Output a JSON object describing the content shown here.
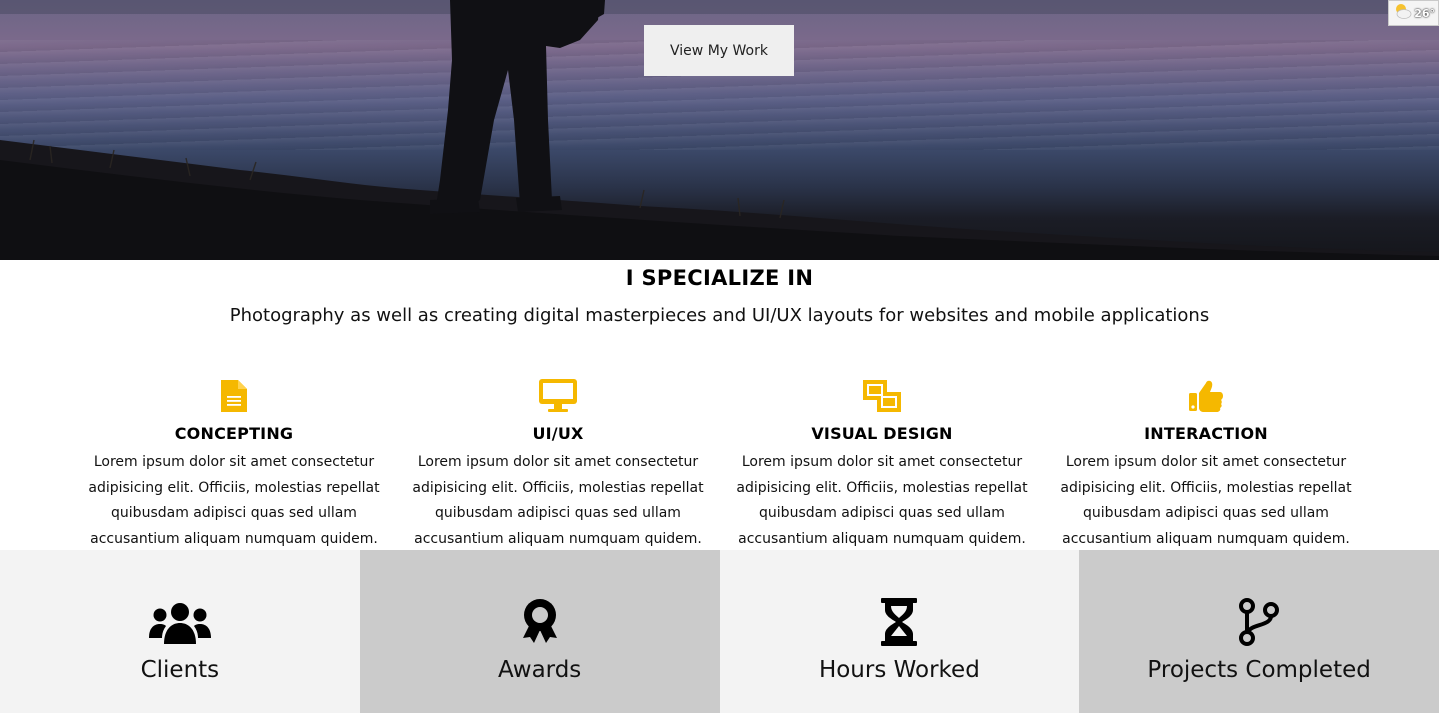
{
  "hero": {
    "button_label": "View My Work"
  },
  "weather": {
    "temperature": "26°",
    "icon": "partly-cloudy-icon"
  },
  "specialize": {
    "title": "I SPECIALIZE IN",
    "subtitle": "Photography as well as creating digital masterpieces and UI/UX layouts for websites and mobile applications",
    "accent_color": "#f5b800",
    "services": [
      {
        "icon": "document-icon",
        "name": "CONCEPTING",
        "description": "Lorem ipsum dolor sit amet consectetur adipisicing elit. Officiis, molestias repellat quibusdam adipisci quas sed ullam accusantium aliquam numquam quidem."
      },
      {
        "icon": "desktop-icon",
        "name": "UI/UX",
        "description": "Lorem ipsum dolor sit amet consectetur adipisicing elit. Officiis, molestias repellat quibusdam adipisci quas sed ullam accusantium aliquam numquam quidem."
      },
      {
        "icon": "object-ungroup-icon",
        "name": "VISUAL DESIGN",
        "description": "Lorem ipsum dolor sit amet consectetur adipisicing elit. Officiis, molestias repellat quibusdam adipisci quas sed ullam accusantium aliquam numquam quidem."
      },
      {
        "icon": "thumbs-up-icon",
        "name": "INTERACTION",
        "description": "Lorem ipsum dolor sit amet consectetur adipisicing elit. Officiis, molestias repellat quibusdam adipisci quas sed ullam accusantium aliquam numquam quidem."
      }
    ]
  },
  "stats": [
    {
      "icon": "users-icon",
      "label": "Clients",
      "background": "#f3f3f3"
    },
    {
      "icon": "award-icon",
      "label": "Awards",
      "background": "#cbcbcb"
    },
    {
      "icon": "hourglass-icon",
      "label": "Hours Worked",
      "background": "#f3f3f3"
    },
    {
      "icon": "code-branch-icon",
      "label": "Projects Completed",
      "background": "#cbcbcb"
    }
  ]
}
